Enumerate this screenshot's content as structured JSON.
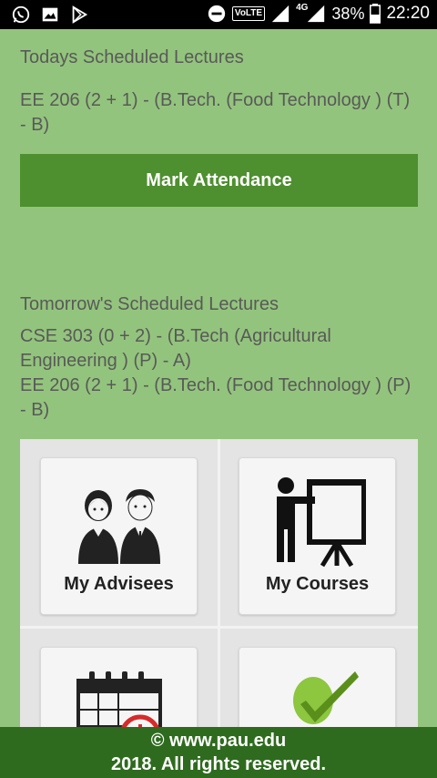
{
  "status_bar": {
    "left_icons": [
      "whatsapp-icon",
      "gallery-icon",
      "play-store-icon"
    ],
    "volte": "VoLTE",
    "network": "4G",
    "battery": "38%",
    "time": "22:20"
  },
  "today": {
    "title": "Todays Scheduled Lectures",
    "lectures": [
      "EE 206 (2 + 1) - (B.Tech. (Food Technology ) (T) - B)"
    ],
    "button_label": "Mark Attendance"
  },
  "tomorrow": {
    "title": "Tomorrow's Scheduled Lectures",
    "lectures": [
      "CSE 303 (0 + 2) - (B.Tech (Agricultural Engineering ) (P) - A)",
      "EE 206 (2 + 1) - (B.Tech. (Food Technology ) (P) - B)"
    ]
  },
  "tiles": [
    {
      "label": "My Advisees",
      "icon": "advisees-icon"
    },
    {
      "label": "My Courses",
      "icon": "courses-icon"
    },
    {
      "label": "",
      "icon": "calendar-icon"
    },
    {
      "label": "",
      "icon": "approval-icon"
    }
  ],
  "footer": {
    "line1": "© www.pau.edu",
    "line2": "2018. All rights reserved."
  },
  "colors": {
    "background": "#93c47d",
    "button": "#4e8f2f",
    "footer": "#2e6b1e"
  }
}
